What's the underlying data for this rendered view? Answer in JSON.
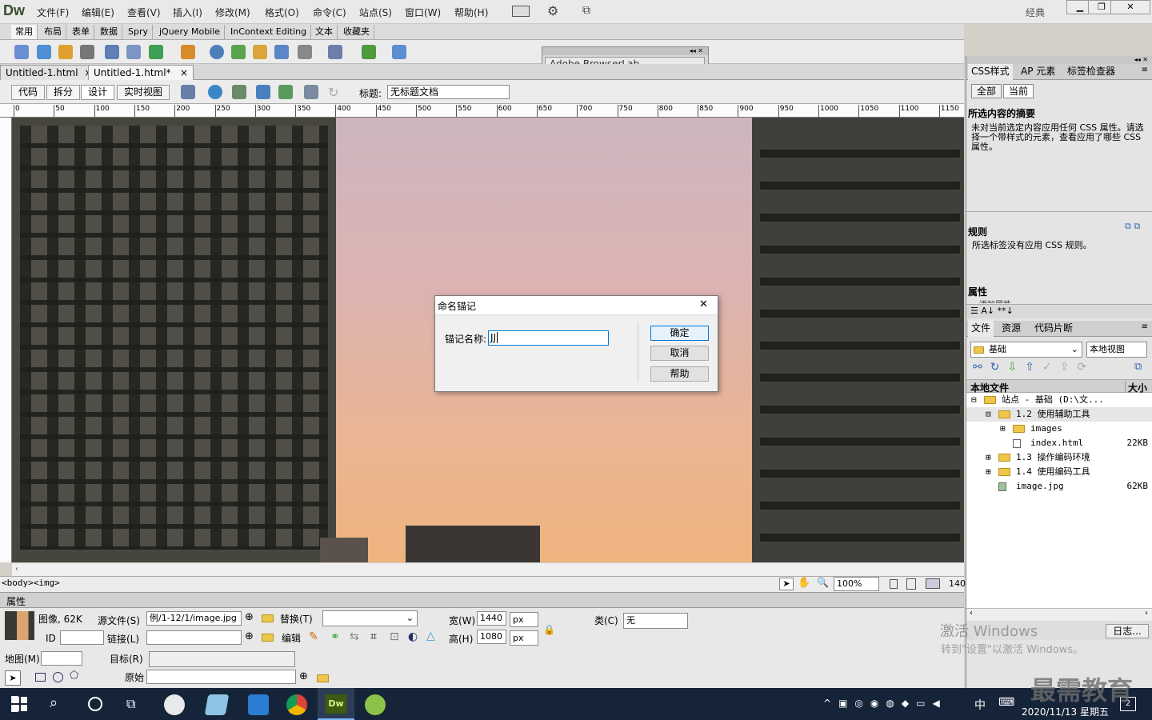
{
  "app": {
    "logo": "Dw",
    "workspace": "经典",
    "min": "▁",
    "restore": "❐",
    "close": "✕"
  },
  "menu": [
    "文件(F)",
    "编辑(E)",
    "查看(V)",
    "插入(I)",
    "修改(M)",
    "格式(O)",
    "命令(C)",
    "站点(S)",
    "窗口(W)",
    "帮助(H)"
  ],
  "insert_tabs": [
    "常用",
    "布局",
    "表单",
    "数据",
    "Spry",
    "jQuery Mobile",
    "InContext Editing",
    "文本",
    "收藏夹"
  ],
  "doc_tabs": [
    {
      "label": "Untitled-1.html",
      "close": "×"
    },
    {
      "label": "Untitled-1.html*",
      "close": "×"
    }
  ],
  "views": [
    "代码",
    "拆分",
    "设计",
    "实时视图"
  ],
  "title_label": "标题:",
  "title_value": "无标题文档",
  "ruler_ticks": [
    "0",
    "50",
    "100",
    "150",
    "200",
    "250",
    "300",
    "350",
    "400",
    "450",
    "500",
    "550",
    "600",
    "650",
    "700",
    "750",
    "800",
    "850",
    "900",
    "950",
    "1000",
    "1050",
    "1100",
    "1150"
  ],
  "tag_selector": "<body><img>",
  "zoom": "100%",
  "status_right": "140",
  "browserlab": {
    "title": "Adobe BrowserLab"
  },
  "dialog": {
    "title": "命名锚记",
    "label": "锚记名称:",
    "value": "JJ",
    "ok": "确定",
    "cancel": "取消",
    "help": "帮助",
    "close": "✕"
  },
  "properties": {
    "header": "属性",
    "type": "图像, 62K",
    "src_label": "源文件(S)",
    "src_value": "例/1-12/1/image.jpg",
    "alt_label": "替换(T)",
    "width_label": "宽(W)",
    "width_value": "1440",
    "height_label": "高(H)",
    "height_value": "1080",
    "unit": "px",
    "class_label": "类(C)",
    "class_value": "无",
    "id_label": "ID",
    "link_label": "链接(L)",
    "edit_label": "编辑",
    "map_label": "地图(M)",
    "target_label": "目标(R)",
    "original_label": "原始"
  },
  "css_panel": {
    "tabs": [
      "CSS样式",
      "AP 元素",
      "标签检查器"
    ],
    "mode_all": "全部",
    "mode_current": "当前",
    "summary_title": "所选内容的摘要",
    "summary_text": "未对当前选定内容应用任何 CSS 属性。请选择一个带样式的元素，查看应用了哪些 CSS 属性。",
    "rules_title": "规则",
    "rules_text": "所选标签没有应用 CSS 规则。",
    "props_title": "属性",
    "add_prop": "添加属性"
  },
  "files_panel": {
    "tabs": [
      "文件",
      "资源",
      "代码片断"
    ],
    "site": "基础",
    "view": "本地视图",
    "col_local": "本地文件",
    "col_size": "大小",
    "rows": [
      {
        "toggle": "⊟",
        "name": "站点 - 基础 (D:\\文...",
        "size": "",
        "indent": 0,
        "kind": "folder"
      },
      {
        "toggle": "⊟",
        "name": "1.2 使用辅助工具",
        "size": "",
        "indent": 1,
        "kind": "folder"
      },
      {
        "toggle": "⊞",
        "name": "images",
        "size": "",
        "indent": 2,
        "kind": "folder"
      },
      {
        "toggle": "",
        "name": "index.html",
        "size": "22KB",
        "indent": 2,
        "kind": "file"
      },
      {
        "toggle": "⊞",
        "name": "1.3  操作编码环境",
        "size": "",
        "indent": 1,
        "kind": "folder"
      },
      {
        "toggle": "⊞",
        "name": "1.4  使用编码工具",
        "size": "",
        "indent": 1,
        "kind": "folder"
      },
      {
        "toggle": "",
        "name": "image.jpg",
        "size": "62KB",
        "indent": 1,
        "kind": "image"
      }
    ],
    "log": "日志..."
  },
  "watermark": {
    "activate": "激活 Windows",
    "activate_sub": "转到\"设置\"以激活 Windows。",
    "brand": "最需教育"
  },
  "taskbar": {
    "ime": "中",
    "time": "",
    "date": "2020/11/13 星期五",
    "notif": "2"
  },
  "colors": {
    "accent": "#0078d7",
    "taskbar": "#16243a",
    "dw_active": "#3d5a10"
  }
}
